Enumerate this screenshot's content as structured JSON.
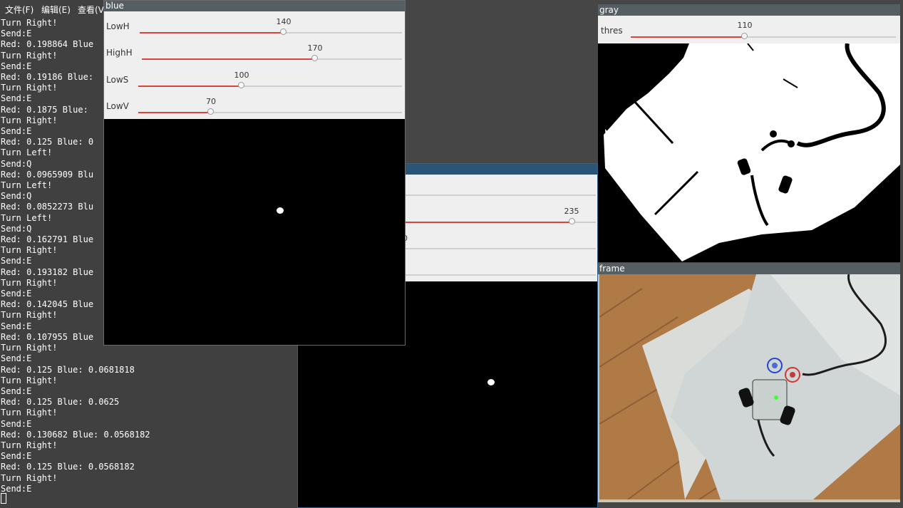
{
  "terminal": {
    "menu": [
      "文件(F)",
      "编辑(E)",
      "查看(V"
    ],
    "lines": [
      "Turn Right!",
      "Send:E",
      "Red: 0.198864 Blue",
      "Turn Right!",
      "Send:E",
      "Red: 0.19186 Blue:",
      "Turn Right!",
      "Send:E",
      "Red: 0.1875 Blue: ",
      "Turn Right!",
      "Send:E",
      "Red: 0.125 Blue: 0",
      "Turn Left!",
      "Send:Q",
      "Red: 0.0965909 Blu",
      "Turn Left!",
      "Send:Q",
      "Red: 0.0852273 Blu",
      "Turn Left!",
      "Send:Q",
      "Red: 0.162791 Blue",
      "Turn Right!",
      "Send:E",
      "Red: 0.193182 Blue",
      "Turn Right!",
      "Send:E",
      "Red: 0.142045 Blue",
      "Turn Right!",
      "Send:E",
      "Red: 0.107955 Blue",
      "Turn Right!",
      "Send:E",
      "Red: 0.125 Blue: 0.0681818",
      "Turn Right!",
      "Send:E",
      "Red: 0.125 Blue: 0.0625",
      "Turn Right!",
      "Send:E",
      "Red: 0.130682 Blue: 0.0568182",
      "Turn Right!",
      "Send:E",
      "Red: 0.125 Blue: 0.0568182",
      "Turn Right!",
      "Send:E"
    ]
  },
  "blue_window": {
    "title": "blue",
    "sliders": [
      {
        "label": "LowH",
        "value": "140",
        "fraction": 0.549
      },
      {
        "label": "HighH",
        "value": "170",
        "fraction": 0.667
      },
      {
        "label": "LowS",
        "value": "100",
        "fraction": 0.392
      },
      {
        "label": "LowV",
        "value": "70",
        "fraction": 0.275
      }
    ]
  },
  "red_window": {
    "visible_values": [
      "235",
      "0"
    ],
    "slider_fraction": 0.922
  },
  "gray_window": {
    "title": "gray",
    "slider": {
      "label": "thres",
      "value": "110",
      "fraction": 0.431
    }
  },
  "frame_window": {
    "title": "frame"
  },
  "colors": {
    "accent": "#d9443c",
    "active_titlebar": "#2a5577",
    "inactive_titlebar": "#555f63"
  }
}
